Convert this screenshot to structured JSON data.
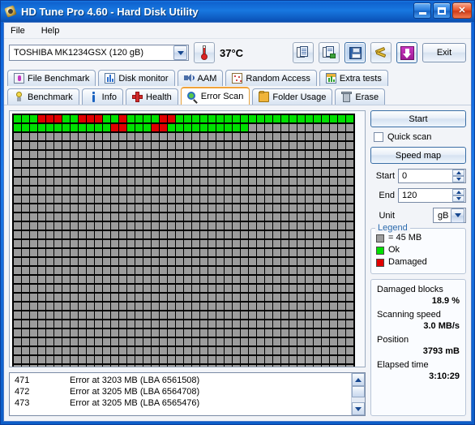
{
  "window": {
    "title": "HD Tune Pro 4.60 - Hard Disk Utility",
    "icon": "hdd-key-icon",
    "minimize_label": "",
    "maximize_label": "",
    "close_label": "✕"
  },
  "menu": [
    {
      "label": "File"
    },
    {
      "label": "Help"
    }
  ],
  "toolbar": {
    "drive": "TOSHIBA MK1234GSX (120 gB)",
    "temperature": "37°C",
    "buttons": [
      {
        "name": "copy-button",
        "icon": "copy-icon"
      },
      {
        "name": "copy-image-button",
        "icon": "copy-image-icon"
      },
      {
        "name": "save-button",
        "icon": "floppy-save-icon",
        "pressed": true
      },
      {
        "name": "options-button",
        "icon": "tools-icon"
      },
      {
        "name": "download-button",
        "icon": "download-arrow-icon"
      }
    ],
    "exit_label": "Exit"
  },
  "tabs": {
    "row1": [
      {
        "label": "File Benchmark",
        "icon": "file-benchmark-icon",
        "active": false
      },
      {
        "label": "Disk monitor",
        "icon": "disk-monitor-icon",
        "active": false
      },
      {
        "label": "AAM",
        "icon": "aam-speaker-icon",
        "active": false
      },
      {
        "label": "Random Access",
        "icon": "random-access-icon",
        "active": false
      },
      {
        "label": "Extra tests",
        "icon": "extra-tests-icon",
        "active": false
      }
    ],
    "row2": [
      {
        "label": "Benchmark",
        "icon": "benchmark-bulb-icon",
        "active": false
      },
      {
        "label": "Info",
        "icon": "info-icon",
        "active": false
      },
      {
        "label": "Health",
        "icon": "health-cross-icon",
        "active": false
      },
      {
        "label": "Error Scan",
        "icon": "error-scan-magnifier-icon",
        "active": true
      },
      {
        "label": "Folder Usage",
        "icon": "folder-icon",
        "active": false
      },
      {
        "label": "Erase",
        "icon": "erase-trash-icon",
        "active": false
      }
    ]
  },
  "controls": {
    "start_button": "Start",
    "quick_scan_label": "Quick scan",
    "quick_scan_checked": false,
    "speed_map_button": "Speed map",
    "start_label": "Start",
    "start_value": "0",
    "end_label": "End",
    "end_value": "120",
    "unit_label": "Unit",
    "unit_value": "gB"
  },
  "legend": {
    "title": "Legend",
    "block_size": "= 45 MB",
    "ok_label": "Ok",
    "damaged_label": "Damaged",
    "colors": {
      "unscanned": "#9c9c9c",
      "ok": "#00e000",
      "damaged": "#e00000"
    }
  },
  "stats": [
    {
      "label": "Damaged blocks",
      "value": "18.9 %"
    },
    {
      "label": "Scanning speed",
      "value": "3.0 MB/s"
    },
    {
      "label": "Position",
      "value": "3793 mB"
    },
    {
      "label": "Elapsed time",
      "value": "3:10:29"
    }
  ],
  "error_log": {
    "rows": [
      {
        "num": "471",
        "text": "Error at 3203 MB (LBA 6561508)"
      },
      {
        "num": "472",
        "text": "Error at 3205 MB (LBA 6564708)"
      },
      {
        "num": "473",
        "text": "Error at 3205 MB (LBA 6565476)"
      }
    ]
  },
  "block_map": {
    "columns": 42,
    "rows": 30,
    "row1": [
      "ok",
      "ok",
      "ok",
      "bad",
      "bad",
      "bad",
      "ok",
      "ok",
      "bad",
      "bad",
      "bad",
      "ok",
      "ok",
      "bad",
      "ok",
      "ok",
      "ok",
      "ok",
      "bad",
      "bad",
      "ok",
      "ok",
      "ok",
      "ok",
      "ok",
      "ok",
      "ok",
      "ok",
      "ok",
      "ok",
      "ok",
      "ok",
      "ok",
      "ok",
      "ok",
      "ok",
      "ok",
      "ok",
      "ok",
      "ok",
      "ok",
      "ok"
    ],
    "row2": [
      "ok",
      "ok",
      "ok",
      "ok",
      "ok",
      "ok",
      "ok",
      "ok",
      "ok",
      "ok",
      "ok",
      "ok",
      "bad",
      "bad",
      "ok",
      "ok",
      "ok",
      "bad",
      "bad",
      "ok",
      "ok",
      "ok",
      "ok",
      "ok",
      "ok",
      "ok",
      "ok",
      "ok",
      "ok"
    ]
  }
}
